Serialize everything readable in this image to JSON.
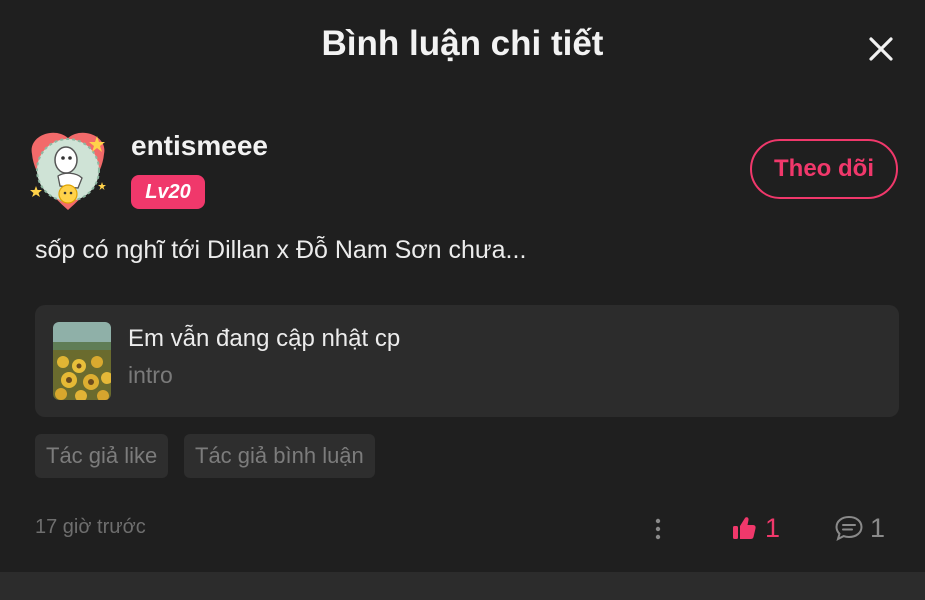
{
  "header": {
    "title": "Bình luận chi tiết",
    "close_icon": "close-icon"
  },
  "comment": {
    "username": "entismeee",
    "level": "Lv20",
    "follow_label": "Theo dõi",
    "text": "sốp có nghĩ tới Dillan x Đỗ Nam Sơn chưa...",
    "timestamp": "17 giờ trước",
    "like_count": "1",
    "reply_count": "1"
  },
  "story": {
    "title": "Em vẫn đang cập nhật cp",
    "subtitle": "intro"
  },
  "tags": [
    {
      "label": "Tác giả like"
    },
    {
      "label": "Tác giả bình luận"
    }
  ],
  "icons": {
    "more": "more-vertical-icon",
    "like": "thumbs-up-icon",
    "reply": "comment-bubble-icon"
  },
  "colors": {
    "accent": "#f0386b",
    "background": "#1f1f1f",
    "card": "#2c2c2c",
    "muted_text": "#7a7a7a"
  }
}
